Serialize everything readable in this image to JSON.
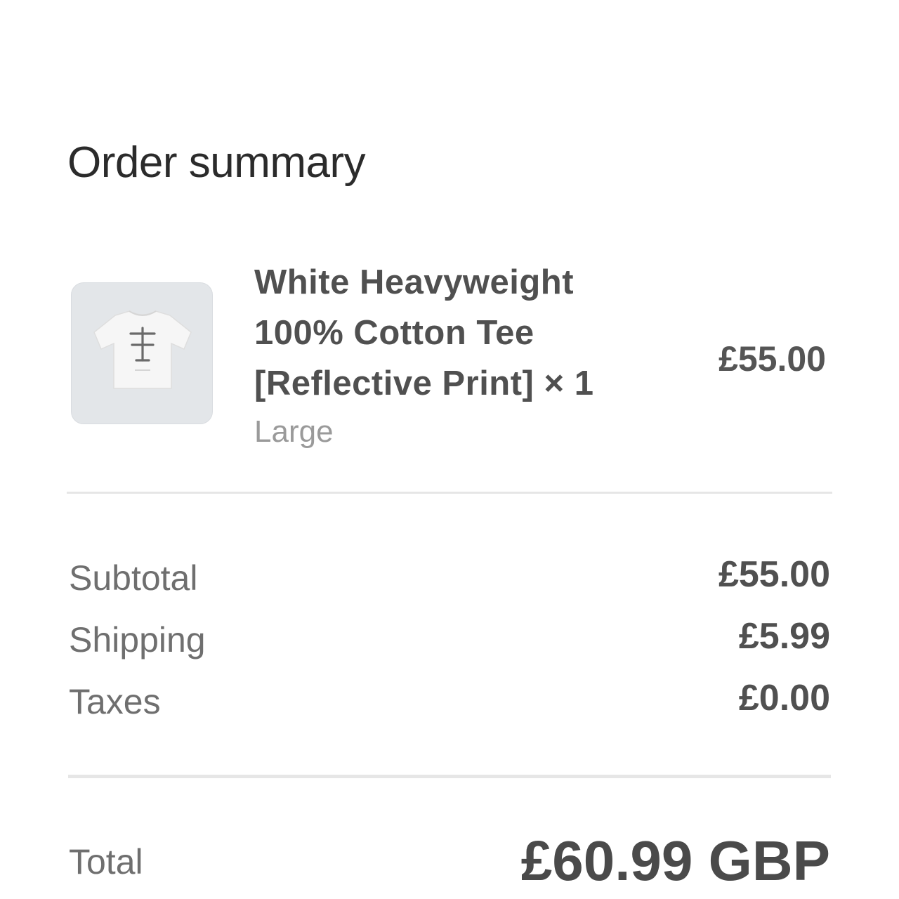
{
  "order_summary": {
    "title": "Order summary",
    "item": {
      "name_lines": [
        "White Heavyweight",
        "100% Cotton Tee",
        "[Reflective Print] × 1"
      ],
      "variant": "Large",
      "price": "£55.00",
      "thumbnail_icon": "t-shirt-icon"
    },
    "rows": [
      {
        "label": "Subtotal",
        "value": "£55.00"
      },
      {
        "label": "Shipping",
        "value": "£5.99"
      },
      {
        "label": "Taxes",
        "value": "£0.00"
      }
    ],
    "total": {
      "label": "Total",
      "value": "£60.99 GBP"
    }
  }
}
